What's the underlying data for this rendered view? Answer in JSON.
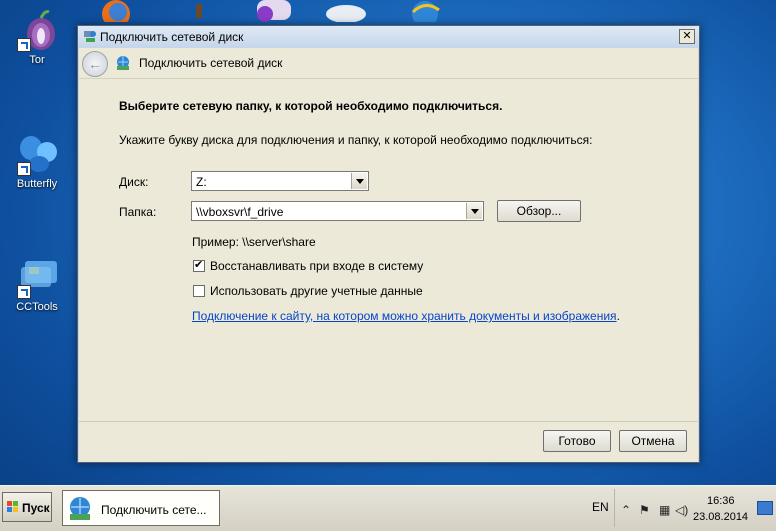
{
  "desktop": {
    "icons": [
      {
        "label": "Tor"
      },
      {
        "label": "Butterfly"
      },
      {
        "label": "CCTools"
      }
    ]
  },
  "dialog": {
    "title": "Подключить сетевой диск",
    "nav_title": "Подключить сетевой диск",
    "close_glyph": "✕",
    "heading": "Выберите сетевую папку, к которой необходимо подключиться.",
    "description": "Укажите букву диска для подключения и папку, к которой необходимо подключиться:",
    "drive_label": "Диск:",
    "drive_value": "Z:",
    "folder_label": "Папка:",
    "folder_value": "\\\\vboxsvr\\f_drive",
    "browse_label": "Обзор...",
    "example": "Пример: \\\\server\\share",
    "reconnect_label": "Восстанавливать при входе в систему",
    "reconnect_checked": true,
    "credentials_label": "Использовать другие учетные данные",
    "credentials_checked": false,
    "link_text": "Подключение к сайту, на котором можно хранить документы и изображения",
    "link_suffix": ".",
    "ok_label": "Готово",
    "cancel_label": "Отмена"
  },
  "taskbar": {
    "start_label": "Пуск",
    "task_label": "Подключить сете...",
    "language": "EN",
    "time": "16:36",
    "date": "23.08.2014"
  },
  "colors": {
    "link": "#0645c8",
    "desktop": "#1f6fc2"
  }
}
